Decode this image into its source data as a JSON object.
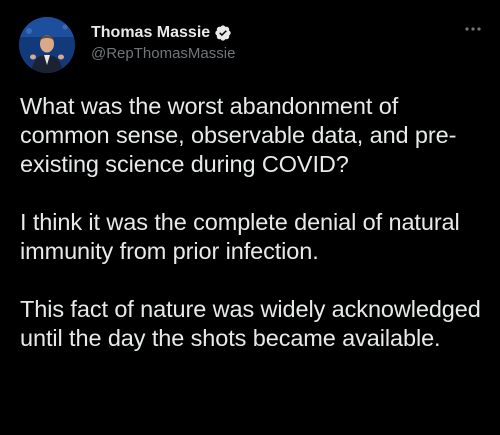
{
  "author": {
    "display_name": "Thomas Massie",
    "handle": "@RepThomasMassie",
    "verified": true,
    "verified_icon": "verified-badge-icon",
    "avatar_icon": "avatar"
  },
  "menu": {
    "icon": "more-options-icon"
  },
  "tweet": {
    "paragraphs": [
      "What was the worst abandonment of common sense, observable data, and pre-existing science during COVID?",
      "I think it was the complete denial of natural immunity from prior infection.",
      "This fact of nature was widely acknowledged until the day the shots became available."
    ]
  },
  "colors": {
    "background": "#000000",
    "text": "#e7e9ea",
    "secondary_text": "#71767b",
    "verified_blue": "#1d9bf0"
  }
}
